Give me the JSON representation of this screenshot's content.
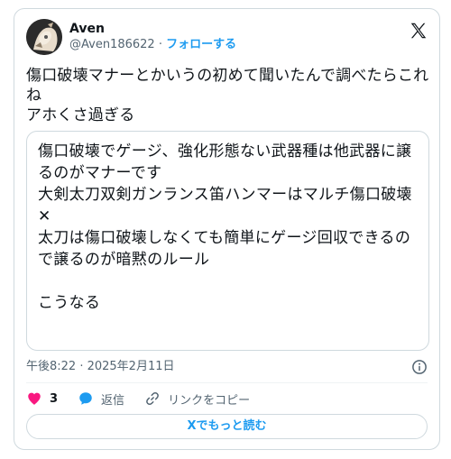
{
  "author": {
    "display_name": "Aven",
    "handle": "@Aven186622",
    "separator": "·",
    "follow_label": "フォローする"
  },
  "tweet": {
    "text": "傷口破壊マナーとかいうの初めて聞いたんで調べたらこれね\nアホくさ過ぎる"
  },
  "quote": {
    "text": "傷口破壊でゲージ、強化形態ない武器種は他武器に譲るのがマナーです\n大剣太刀双剣ガンランス笛ハンマーはマルチ傷口破壊✕\n太刀は傷口破壊しなくても簡単にゲージ回収できるので譲るのが暗黙のルール\n\nこうなる"
  },
  "meta": {
    "timestamp": "午後8:22 · 2025年2月11日"
  },
  "actions": {
    "like_count": "3",
    "reply_label": "返信",
    "copy_link_label": "リンクをコピー"
  },
  "more_button_label": "Xでもっと読む",
  "colors": {
    "accent": "#1d9bf0",
    "like": "#f91880",
    "text": "#0f1419",
    "secondary": "#536471",
    "border": "#cfd9de"
  },
  "icons": [
    "avatar",
    "x-logo-icon",
    "info-icon",
    "heart-icon",
    "reply-bubble-icon",
    "link-icon"
  ]
}
